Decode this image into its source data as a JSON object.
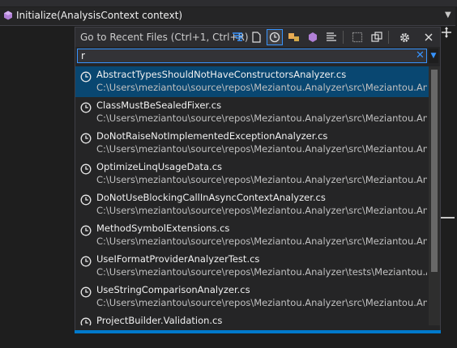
{
  "member_bar": {
    "text": "Initialize(AnalysisContext context)"
  },
  "popup": {
    "title": "Go to Recent Files (Ctrl+1, Ctrl+R)",
    "search_value": "r",
    "toolbar_icons": [
      "filter-list-icon",
      "file-icon",
      "recent-files-icon",
      "types-icon",
      "members-icon",
      "text-icon",
      "current-document-icon",
      "preview-icon",
      "settings-icon",
      "close-icon"
    ]
  },
  "results": [
    {
      "name": "AbstractTypesShouldNotHaveConstructorsAnalyzer.cs",
      "path": "C:\\Users\\meziantou\\source\\repos\\Meziantou.Analyzer\\src\\Meziantou.Anal..."
    },
    {
      "name": "ClassMustBeSealedFixer.cs",
      "path": "C:\\Users\\meziantou\\source\\repos\\Meziantou.Analyzer\\src\\Meziantou.Anal..."
    },
    {
      "name": "DoNotRaiseNotImplementedExceptionAnalyzer.cs",
      "path": "C:\\Users\\meziantou\\source\\repos\\Meziantou.Analyzer\\src\\Meziantou.Anal..."
    },
    {
      "name": "OptimizeLinqUsageData.cs",
      "path": "C:\\Users\\meziantou\\source\\repos\\Meziantou.Analyzer\\src\\Meziantou.Anal..."
    },
    {
      "name": "DoNotUseBlockingCallInAsyncContextAnalyzer.cs",
      "path": "C:\\Users\\meziantou\\source\\repos\\Meziantou.Analyzer\\src\\Meziantou.Anal..."
    },
    {
      "name": "MethodSymbolExtensions.cs",
      "path": "C:\\Users\\meziantou\\source\\repos\\Meziantou.Analyzer\\src\\Meziantou.Anal..."
    },
    {
      "name": "UseIFormatProviderAnalyzerTest.cs",
      "path": "C:\\Users\\meziantou\\source\\repos\\Meziantou.Analyzer\\tests\\Meziantou.Ana..."
    },
    {
      "name": "UseStringComparisonAnalyzer.cs",
      "path": "C:\\Users\\meziantou\\source\\repos\\Meziantou.Analyzer\\src\\Meziantou.Anal..."
    },
    {
      "name": "ProjectBuilder.Validation.cs",
      "path": ""
    }
  ],
  "colors": {
    "selection": "#094771",
    "accent": "#3794ff",
    "status": "#007acc"
  }
}
